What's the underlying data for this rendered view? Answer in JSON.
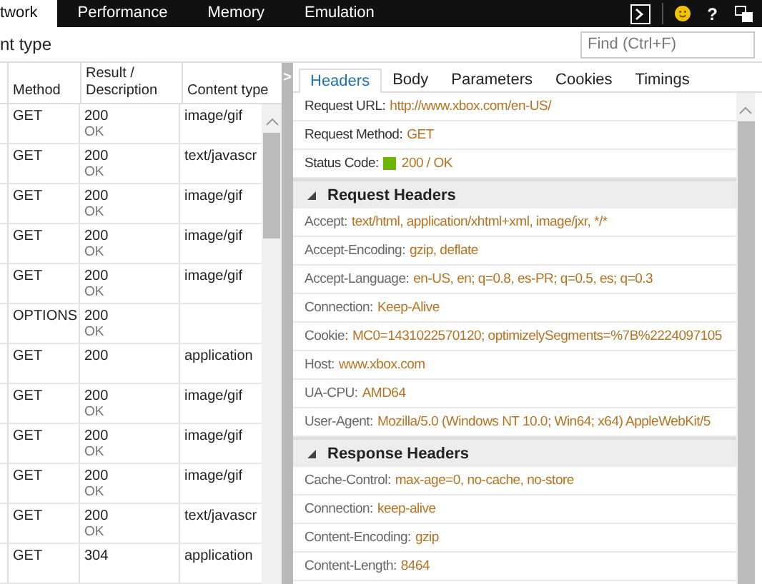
{
  "top_tabs": [
    {
      "label": "twork",
      "selected": true
    },
    {
      "label": "Performance",
      "selected": false
    },
    {
      "label": "Memory",
      "selected": false
    },
    {
      "label": "Emulation",
      "selected": false
    }
  ],
  "help_glyph": "?",
  "filter_label": "nt type",
  "search": {
    "placeholder": "Find (Ctrl+F)"
  },
  "table": {
    "columns": [
      "Method",
      "Result / Description",
      "Content type"
    ],
    "rows": [
      {
        "method": "GET",
        "result": "200",
        "description": "OK",
        "content_type": "image/gif"
      },
      {
        "method": "GET",
        "result": "200",
        "description": "OK",
        "content_type": "text/javascr"
      },
      {
        "method": "GET",
        "result": "200",
        "description": "OK",
        "content_type": "image/gif"
      },
      {
        "method": "GET",
        "result": "200",
        "description": "OK",
        "content_type": "image/gif"
      },
      {
        "method": "GET",
        "result": "200",
        "description": "OK",
        "content_type": "image/gif"
      },
      {
        "method": "OPTIONS",
        "result": "200",
        "description": "OK"
      },
      {
        "method": "GET",
        "result": "200",
        "content_type": "application"
      },
      {
        "method": "GET",
        "result": "200",
        "description": "OK",
        "content_type": "image/gif"
      },
      {
        "method": "GET",
        "result": "200",
        "description": "OK",
        "content_type": "image/gif"
      },
      {
        "method": "GET",
        "result": "200",
        "description": "OK",
        "content_type": "image/gif"
      },
      {
        "method": "GET",
        "result": "200",
        "description": "OK",
        "content_type": "text/javascr"
      },
      {
        "method": "GET",
        "result": "304",
        "content_type": "application"
      }
    ]
  },
  "splitter_glyph": ">",
  "detail_tabs": [
    {
      "label": "Headers",
      "selected": true
    },
    {
      "label": "Body",
      "selected": false
    },
    {
      "label": "Parameters",
      "selected": false
    },
    {
      "label": "Cookies",
      "selected": false
    },
    {
      "label": "Timings",
      "selected": false
    }
  ],
  "summary": [
    {
      "label": "Request URL:",
      "value": "http://www.xbox.com/en-US/"
    },
    {
      "label": "Request Method:",
      "value": "GET"
    },
    {
      "label": "Status Code:",
      "value": "200 / OK",
      "color": "#6bb700"
    }
  ],
  "sections": [
    {
      "title": "Request Headers",
      "expanded": true,
      "headers": [
        {
          "name": "Accept:",
          "value": "text/html, application/xhtml+xml, image/jxr, */*"
        },
        {
          "name": "Accept-Encoding:",
          "value": "gzip, deflate"
        },
        {
          "name": "Accept-Language:",
          "value": "en-US, en; q=0.8, es-PR; q=0.5, es; q=0.3"
        },
        {
          "name": "Connection:",
          "value": "Keep-Alive"
        },
        {
          "name": "Cookie:",
          "value": "MC0=1431022570120; optimizelySegments=%7B%2224097105"
        },
        {
          "name": "Host:",
          "value": "www.xbox.com"
        },
        {
          "name": "UA-CPU:",
          "value": "AMD64"
        },
        {
          "name": "User-Agent:",
          "value": "Mozilla/5.0 (Windows NT 10.0; Win64; x64) AppleWebKit/5"
        }
      ]
    },
    {
      "title": "Response Headers",
      "expanded": true,
      "headers": [
        {
          "name": "Cache-Control:",
          "value": "max-age=0, no-cache, no-store"
        },
        {
          "name": "Connection:",
          "value": "keep-alive"
        },
        {
          "name": "Content-Encoding:",
          "value": "gzip"
        },
        {
          "name": "Content-Length:",
          "value": "8464"
        }
      ]
    }
  ]
}
